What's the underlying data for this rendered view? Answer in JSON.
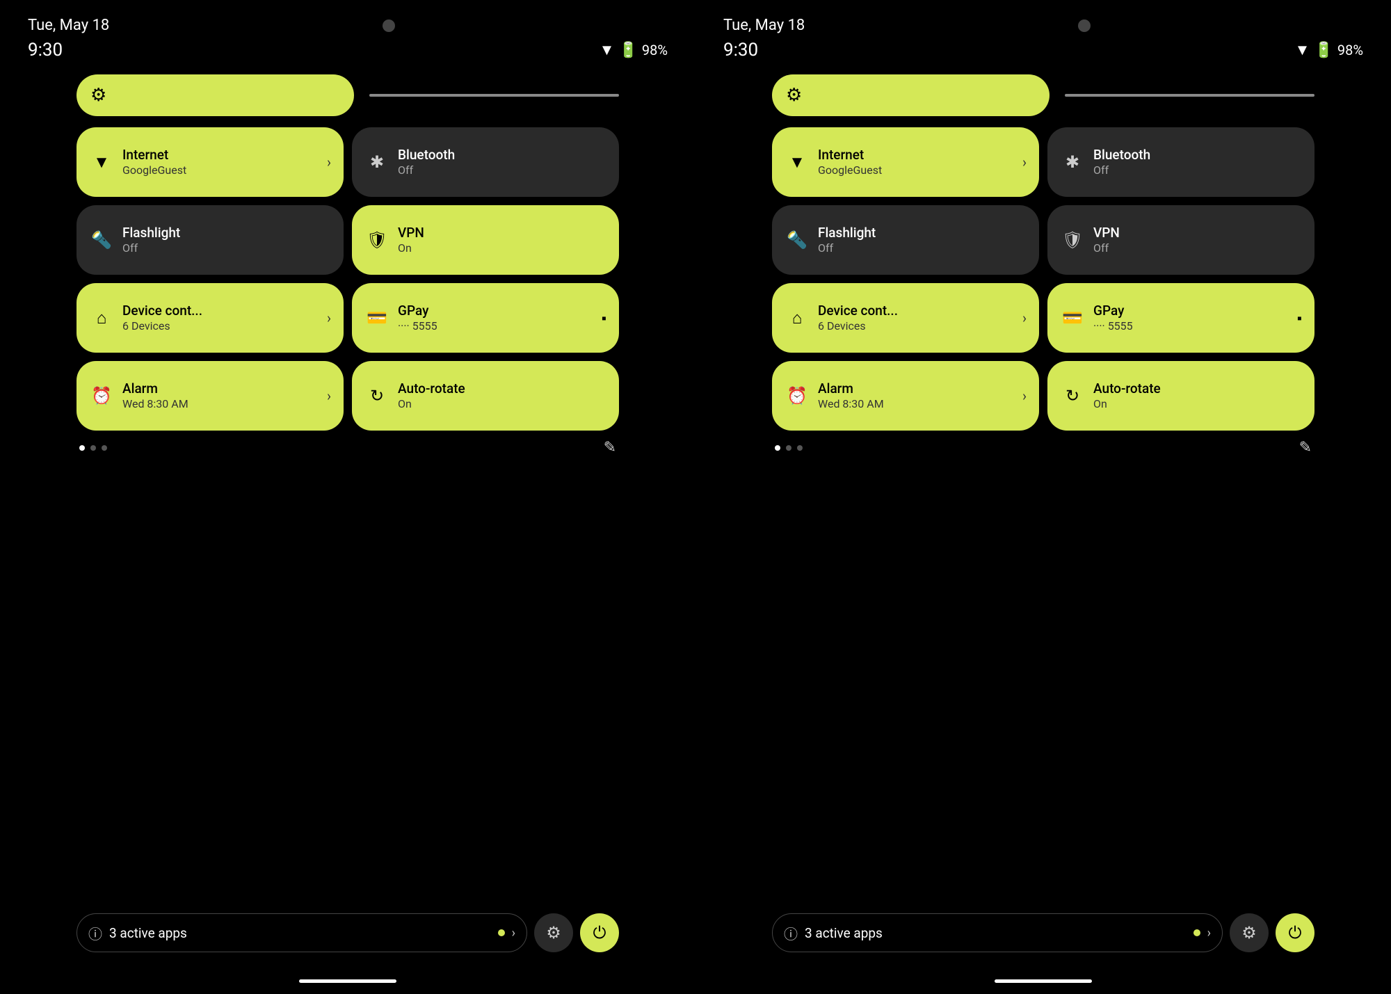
{
  "left": {
    "date": "Tue, May 18",
    "time": "9:30",
    "battery": "98%",
    "brightness_icon": "⚙",
    "tiles": [
      {
        "id": "internet",
        "label": "Internet",
        "sublabel": "GoogleGuest",
        "icon": "wifi",
        "active": true,
        "chevron": true
      },
      {
        "id": "bluetooth",
        "label": "Bluetooth",
        "sublabel": "Off",
        "icon": "bluetooth",
        "active": false,
        "chevron": false
      },
      {
        "id": "flashlight",
        "label": "Flashlight",
        "sublabel": "Off",
        "icon": "flashlight",
        "active": false,
        "chevron": false
      },
      {
        "id": "vpn",
        "label": "VPN",
        "sublabel": "On",
        "icon": "vpn",
        "active": true,
        "chevron": false
      },
      {
        "id": "device-cont",
        "label": "Device cont...",
        "sublabel": "6 Devices",
        "icon": "home",
        "active": true,
        "chevron": true
      },
      {
        "id": "gpay",
        "label": "GPay",
        "sublabel": "···· 5555",
        "icon": "card",
        "active": true,
        "card": true
      },
      {
        "id": "alarm",
        "label": "Alarm",
        "sublabel": "Wed 8:30 AM",
        "icon": "alarm",
        "active": true,
        "chevron": true
      },
      {
        "id": "auto-rotate",
        "label": "Auto-rotate",
        "sublabel": "On",
        "icon": "rotate",
        "active": true,
        "chevron": false
      }
    ],
    "active_apps_count": "3",
    "active_apps_label": "active apps"
  },
  "right": {
    "date": "Tue, May 18",
    "time": "9:30",
    "battery": "98%",
    "tiles": [
      {
        "id": "internet",
        "label": "Internet",
        "sublabel": "GoogleGuest",
        "icon": "wifi",
        "active": true,
        "chevron": true
      },
      {
        "id": "bluetooth",
        "label": "Bluetooth",
        "sublabel": "Off",
        "icon": "bluetooth",
        "active": false,
        "chevron": false
      },
      {
        "id": "flashlight",
        "label": "Flashlight",
        "sublabel": "Off",
        "icon": "flashlight",
        "active": false,
        "chevron": false
      },
      {
        "id": "vpn",
        "label": "VPN",
        "sublabel": "Off",
        "icon": "vpn",
        "active": false,
        "chevron": false
      },
      {
        "id": "device-cont",
        "label": "Device cont...",
        "sublabel": "6 Devices",
        "icon": "home",
        "active": true,
        "chevron": true
      },
      {
        "id": "gpay",
        "label": "GPay",
        "sublabel": "···· 5555",
        "icon": "card",
        "active": true,
        "card": true
      },
      {
        "id": "alarm",
        "label": "Alarm",
        "sublabel": "Wed 8:30 AM",
        "icon": "alarm",
        "active": true,
        "chevron": true
      },
      {
        "id": "auto-rotate",
        "label": "Auto-rotate",
        "sublabel": "On",
        "icon": "rotate",
        "active": true,
        "chevron": false
      }
    ],
    "active_apps_count": "3",
    "active_apps_label": "active apps"
  },
  "icons": {
    "wifi": "▼",
    "bluetooth": "✱",
    "flashlight": "🔦",
    "vpn": "🛡",
    "home": "⌂",
    "card": "💳",
    "alarm": "⏰",
    "rotate": "↻",
    "gear": "⚙",
    "info": "ⓘ",
    "pencil": "✎",
    "power": "⏻",
    "settings": "⚙"
  }
}
